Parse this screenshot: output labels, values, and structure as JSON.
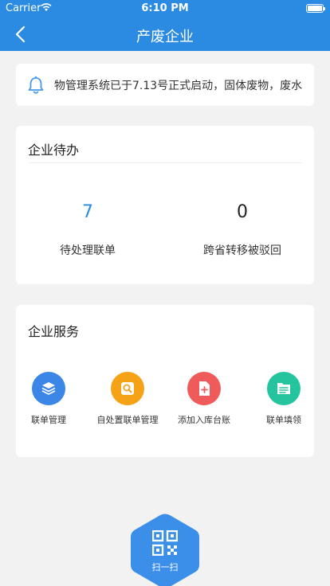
{
  "status_bar": {
    "carrier": "Carrier",
    "time": "6:10 PM"
  },
  "nav": {
    "title": "产废企业"
  },
  "notice": {
    "text": "物管理系统已于7.13号正式启动，固体废物，废水"
  },
  "todo": {
    "title": "企业待办",
    "stats": [
      {
        "value": "7",
        "label": "待处理联单",
        "color": "#2b8be3"
      },
      {
        "value": "0",
        "label": "跨省转移被驳回",
        "color": "#222222"
      }
    ]
  },
  "services": {
    "title": "企业服务",
    "items": [
      {
        "label": "联单管理",
        "color": "#3b86e6",
        "icon": "layers-icon"
      },
      {
        "label": "自处置联单管理",
        "color": "#f6a216",
        "icon": "search-doc-icon"
      },
      {
        "label": "添加入库台账",
        "color": "#ef5b5b",
        "icon": "add-file-icon"
      },
      {
        "label": "联单填领",
        "color": "#25c49e",
        "icon": "form-icon"
      }
    ]
  },
  "scan": {
    "label": "扫一扫",
    "color": "#3b8fe8"
  }
}
